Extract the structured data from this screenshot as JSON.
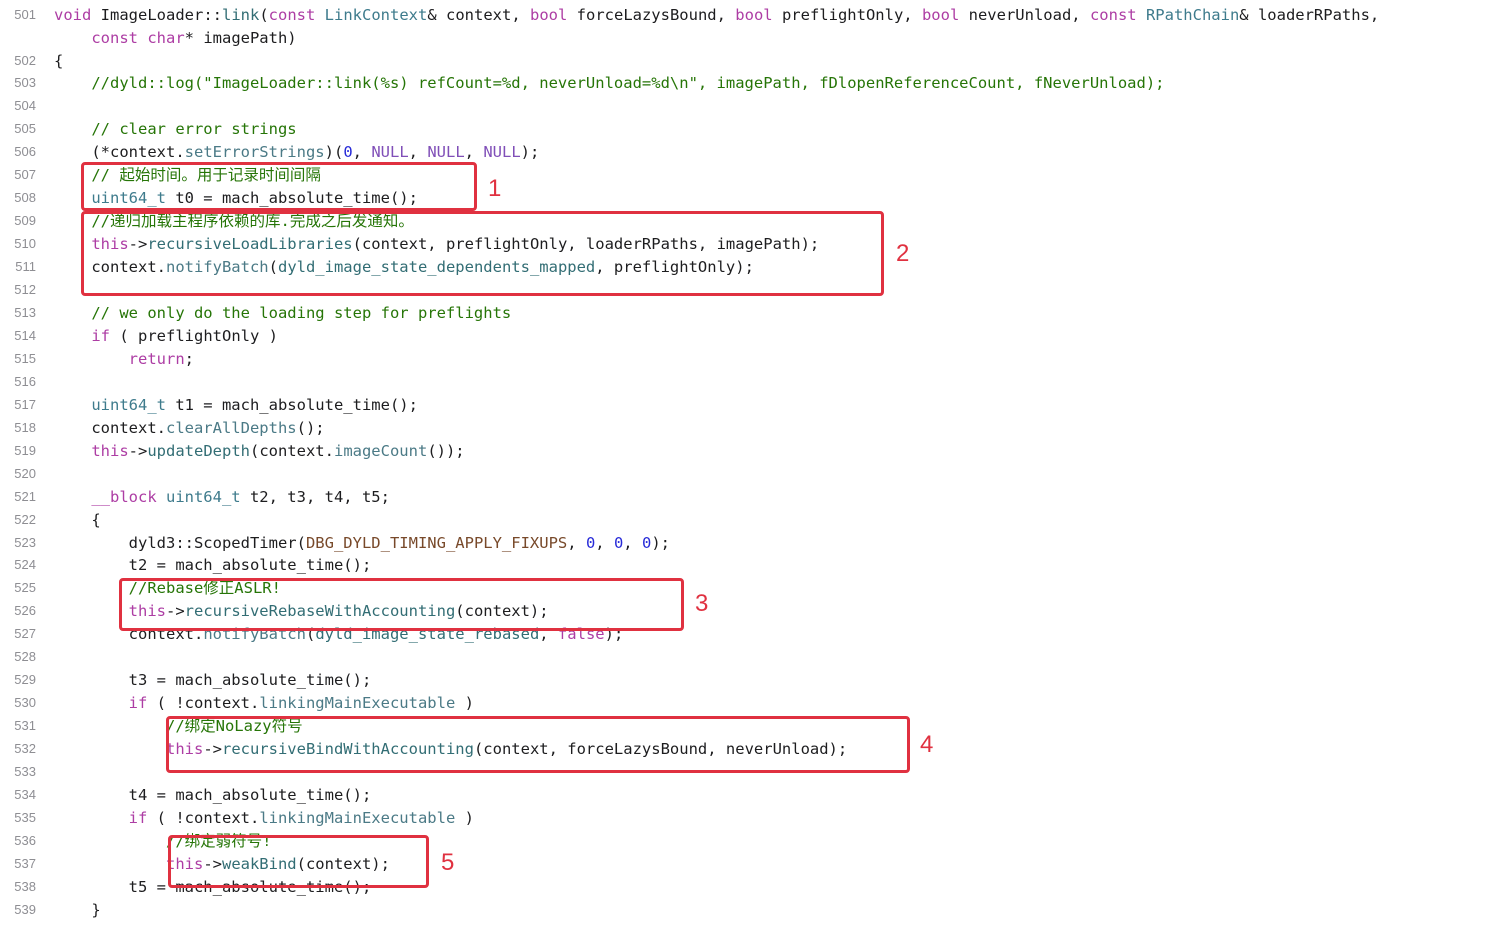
{
  "colors": {
    "keyword": "#ad3da4",
    "type": "#3e7b8c",
    "method": "#326d74",
    "comment": "#267507",
    "constant": "#804fb8",
    "macro": "#78492a",
    "number": "#272ad8",
    "annotation": "#e03140"
  },
  "lines": [
    {
      "no": "501",
      "tokens": [
        [
          "kw",
          "void "
        ],
        [
          "p",
          "ImageLoader::"
        ],
        [
          "fn",
          "link"
        ],
        [
          "p",
          "("
        ],
        [
          "kw",
          "const "
        ],
        [
          "ty",
          "LinkContext"
        ],
        [
          "p",
          "& context, "
        ],
        [
          "kw",
          "bool "
        ],
        [
          "p",
          "forceLazysBound, "
        ],
        [
          "kw",
          "bool "
        ],
        [
          "p",
          "preflightOnly, "
        ],
        [
          "kw",
          "bool "
        ],
        [
          "p",
          "neverUnload, "
        ],
        [
          "kw",
          "const "
        ],
        [
          "ty",
          "RPathChain"
        ],
        [
          "p",
          "& loaderRPaths,"
        ]
      ]
    },
    {
      "no": "",
      "tokens": [
        [
          "p",
          "    "
        ],
        [
          "kw",
          "const char"
        ],
        [
          "p",
          "* imagePath)"
        ]
      ]
    },
    {
      "no": "502",
      "tokens": [
        [
          "p",
          "{"
        ]
      ]
    },
    {
      "no": "503",
      "tokens": [
        [
          "p",
          "    "
        ],
        [
          "cm",
          "//dyld::log(\"ImageLoader::link(%s) refCount=%d, neverUnload=%d\\n\", imagePath, fDlopenReferenceCount, fNeverUnload);"
        ]
      ]
    },
    {
      "no": "504",
      "tokens": []
    },
    {
      "no": "505",
      "tokens": [
        [
          "p",
          "    "
        ],
        [
          "cm",
          "// clear error strings"
        ]
      ]
    },
    {
      "no": "506",
      "tokens": [
        [
          "p",
          "    (*context."
        ],
        [
          "mfn",
          "setErrorStrings"
        ],
        [
          "p",
          ")("
        ],
        [
          "nm",
          "0"
        ],
        [
          "p",
          ", "
        ],
        [
          "cn",
          "NULL"
        ],
        [
          "p",
          ", "
        ],
        [
          "cn",
          "NULL"
        ],
        [
          "p",
          ", "
        ],
        [
          "cn",
          "NULL"
        ],
        [
          "p",
          ");"
        ]
      ]
    },
    {
      "no": "507",
      "tokens": [
        [
          "p",
          "    "
        ],
        [
          "cm",
          "// 起始时间。用于记录时间间隔"
        ]
      ]
    },
    {
      "no": "508",
      "tokens": [
        [
          "p",
          "    "
        ],
        [
          "ty",
          "uint64_t"
        ],
        [
          "p",
          " t0 = mach_absolute_time();"
        ]
      ]
    },
    {
      "no": "509",
      "tokens": [
        [
          "p",
          "    "
        ],
        [
          "cm",
          "//递归加载主程序依赖的库.完成之后发通知。"
        ]
      ]
    },
    {
      "no": "510",
      "tokens": [
        [
          "p",
          "    "
        ],
        [
          "kw",
          "this"
        ],
        [
          "p",
          "->"
        ],
        [
          "fn",
          "recursiveLoadLibraries"
        ],
        [
          "p",
          "(context, preflightOnly, loaderRPaths, imagePath);"
        ]
      ]
    },
    {
      "no": "511",
      "tokens": [
        [
          "p",
          "    context."
        ],
        [
          "mfn",
          "notifyBatch"
        ],
        [
          "p",
          "("
        ],
        [
          "fn",
          "dyld_image_state_dependents_mapped"
        ],
        [
          "p",
          ", preflightOnly);"
        ]
      ]
    },
    {
      "no": "512",
      "tokens": []
    },
    {
      "no": "513",
      "tokens": [
        [
          "p",
          "    "
        ],
        [
          "cm",
          "// we only do the loading step for preflights"
        ]
      ]
    },
    {
      "no": "514",
      "tokens": [
        [
          "p",
          "    "
        ],
        [
          "kw",
          "if"
        ],
        [
          "p",
          " ( preflightOnly )"
        ]
      ]
    },
    {
      "no": "515",
      "tokens": [
        [
          "p",
          "        "
        ],
        [
          "kw",
          "return"
        ],
        [
          "p",
          ";"
        ]
      ]
    },
    {
      "no": "516",
      "tokens": []
    },
    {
      "no": "517",
      "tokens": [
        [
          "p",
          "    "
        ],
        [
          "ty",
          "uint64_t"
        ],
        [
          "p",
          " t1 = mach_absolute_time();"
        ]
      ]
    },
    {
      "no": "518",
      "tokens": [
        [
          "p",
          "    context."
        ],
        [
          "mfn",
          "clearAllDepths"
        ],
        [
          "p",
          "();"
        ]
      ]
    },
    {
      "no": "519",
      "tokens": [
        [
          "p",
          "    "
        ],
        [
          "kw",
          "this"
        ],
        [
          "p",
          "->"
        ],
        [
          "fn",
          "updateDepth"
        ],
        [
          "p",
          "(context."
        ],
        [
          "mfn",
          "imageCount"
        ],
        [
          "p",
          "());"
        ]
      ]
    },
    {
      "no": "520",
      "tokens": []
    },
    {
      "no": "521",
      "tokens": [
        [
          "p",
          "    "
        ],
        [
          "kw",
          "__block "
        ],
        [
          "ty",
          "uint64_t"
        ],
        [
          "p",
          " t2, t3, t4, t5;"
        ]
      ]
    },
    {
      "no": "522",
      "tokens": [
        [
          "p",
          "    {"
        ]
      ]
    },
    {
      "no": "523",
      "tokens": [
        [
          "p",
          "        dyld3::ScopedTimer("
        ],
        [
          "mac",
          "DBG_DYLD_TIMING_APPLY_FIXUPS"
        ],
        [
          "p",
          ", "
        ],
        [
          "nm",
          "0"
        ],
        [
          "p",
          ", "
        ],
        [
          "nm",
          "0"
        ],
        [
          "p",
          ", "
        ],
        [
          "nm",
          "0"
        ],
        [
          "p",
          ");"
        ]
      ]
    },
    {
      "no": "524",
      "tokens": [
        [
          "p",
          "        t2 = mach_absolute_time();"
        ]
      ]
    },
    {
      "no": "525",
      "tokens": [
        [
          "p",
          "        "
        ],
        [
          "cm",
          "//Rebase修正ASLR!"
        ]
      ]
    },
    {
      "no": "526",
      "tokens": [
        [
          "p",
          "        "
        ],
        [
          "kw",
          "this"
        ],
        [
          "p",
          "->"
        ],
        [
          "fn",
          "recursiveRebaseWithAccounting"
        ],
        [
          "p",
          "(context);"
        ]
      ]
    },
    {
      "no": "527",
      "tokens": [
        [
          "p",
          "        context."
        ],
        [
          "mfn",
          "notifyBatch"
        ],
        [
          "p",
          "("
        ],
        [
          "fn",
          "dyld_image_state_rebased"
        ],
        [
          "p",
          ", "
        ],
        [
          "kw",
          "false"
        ],
        [
          "p",
          ");"
        ]
      ]
    },
    {
      "no": "528",
      "tokens": []
    },
    {
      "no": "529",
      "tokens": [
        [
          "p",
          "        t3 = mach_absolute_time();"
        ]
      ]
    },
    {
      "no": "530",
      "tokens": [
        [
          "p",
          "        "
        ],
        [
          "kw",
          "if"
        ],
        [
          "p",
          " ( !context."
        ],
        [
          "mfn",
          "linkingMainExecutable"
        ],
        [
          "p",
          " )"
        ]
      ]
    },
    {
      "no": "531",
      "tokens": [
        [
          "p",
          "            "
        ],
        [
          "cm",
          "//绑定NoLazy符号"
        ]
      ]
    },
    {
      "no": "532",
      "tokens": [
        [
          "p",
          "            "
        ],
        [
          "kw",
          "this"
        ],
        [
          "p",
          "->"
        ],
        [
          "fn",
          "recursiveBindWithAccounting"
        ],
        [
          "p",
          "(context, forceLazysBound, neverUnload);"
        ]
      ]
    },
    {
      "no": "533",
      "tokens": []
    },
    {
      "no": "534",
      "tokens": [
        [
          "p",
          "        t4 = mach_absolute_time();"
        ]
      ]
    },
    {
      "no": "535",
      "tokens": [
        [
          "p",
          "        "
        ],
        [
          "kw",
          "if"
        ],
        [
          "p",
          " ( !context."
        ],
        [
          "mfn",
          "linkingMainExecutable"
        ],
        [
          "p",
          " )"
        ]
      ]
    },
    {
      "no": "536",
      "tokens": [
        [
          "p",
          "            "
        ],
        [
          "cm",
          "//绑定弱符号!"
        ]
      ]
    },
    {
      "no": "537",
      "tokens": [
        [
          "p",
          "            "
        ],
        [
          "kw",
          "this"
        ],
        [
          "p",
          "->"
        ],
        [
          "fn",
          "weakBind"
        ],
        [
          "p",
          "(context);"
        ]
      ]
    },
    {
      "no": "538",
      "tokens": [
        [
          "p",
          "        t5 = mach_absolute_time();"
        ]
      ]
    },
    {
      "no": "539",
      "tokens": [
        [
          "p",
          "    }"
        ]
      ]
    }
  ],
  "annotations": [
    {
      "label": "1"
    },
    {
      "label": "2"
    },
    {
      "label": "3"
    },
    {
      "label": "4"
    },
    {
      "label": "5"
    }
  ]
}
